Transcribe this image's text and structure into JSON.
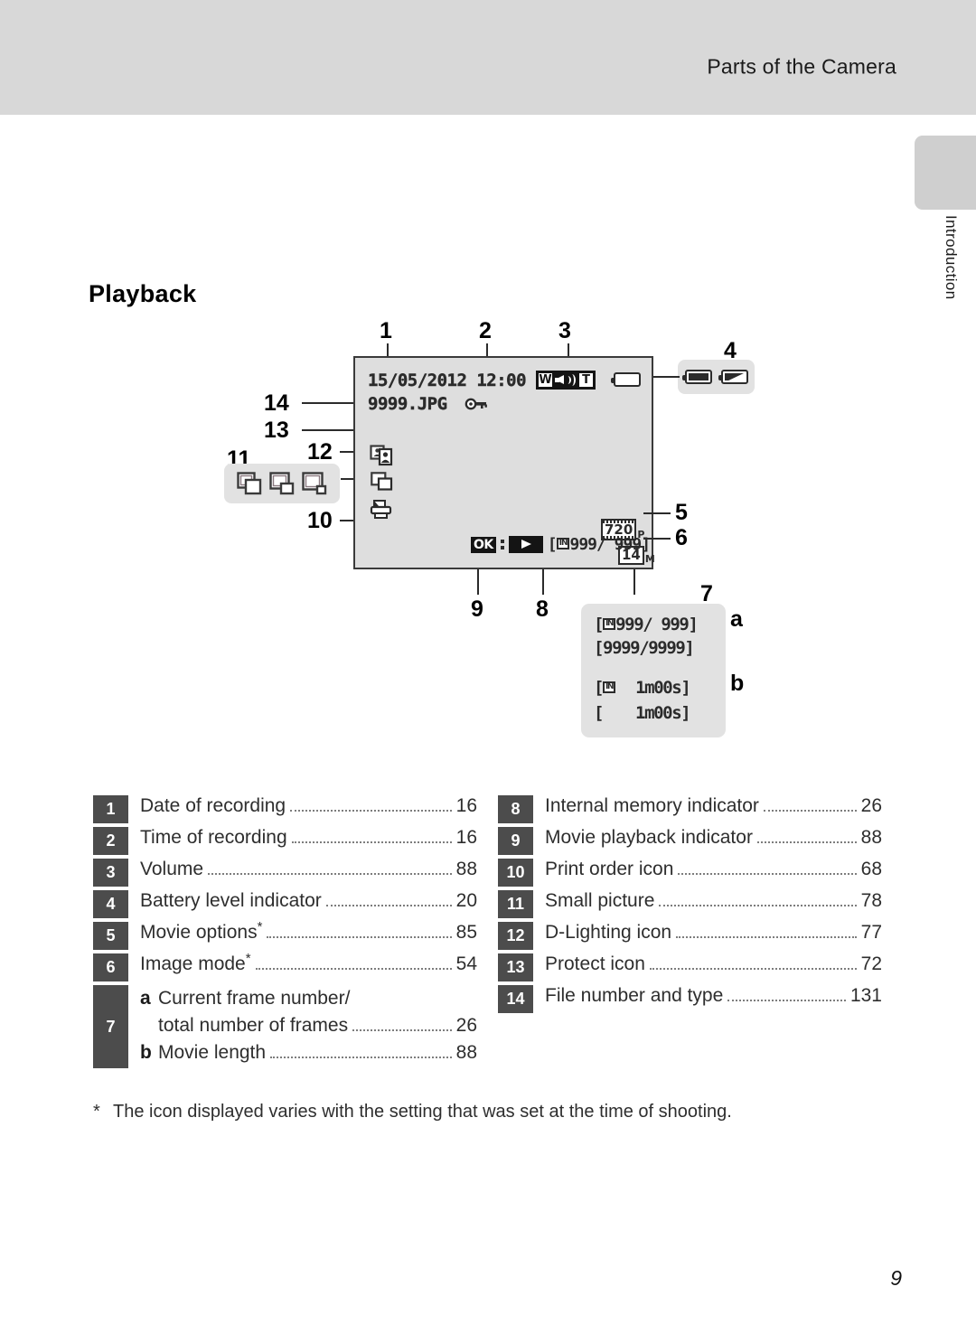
{
  "header": {
    "title": "Parts of the Camera"
  },
  "side_tab": {
    "label": "Introduction"
  },
  "section": {
    "heading": "Playback"
  },
  "lcd": {
    "date": "15/05/2012",
    "time": "12:00",
    "filename": "9999.JPG",
    "volume": {
      "wide_label": "W",
      "tele_label": "T",
      "speaker_icon": "speaker-icon"
    },
    "battery_icon": "battery-icon",
    "movie_options": {
      "value": "720",
      "suffix": "P"
    },
    "image_mode": {
      "value": "14",
      "suffix": "M"
    },
    "bottom": {
      "ok_label": "OK",
      "play_icon": "play-icon",
      "memory_badge": "IN",
      "frame_counter": "999/ 999",
      "bracket_open": "[",
      "bracket_close": "]"
    },
    "icons": {
      "protect": "key-icon",
      "d_lighting": "d-lighting-icon",
      "small_picture": "small-picture-icon",
      "print_order": "printer-icon"
    }
  },
  "battery_group": {
    "icons": [
      "battery-full-icon",
      "battery-low-icon"
    ]
  },
  "small_picture_group": {
    "icons": [
      "small-picture-large-icon",
      "small-picture-medium-icon",
      "small-picture-small-icon"
    ]
  },
  "callouts": {
    "n1": "1",
    "n2": "2",
    "n3": "3",
    "n4": "4",
    "n5": "5",
    "n6": "6",
    "n7": "7",
    "n8": "8",
    "n9": "9",
    "n10": "10",
    "n11": "11",
    "n12": "12",
    "n13": "13",
    "n14": "14",
    "sub_a": "a",
    "sub_b": "b"
  },
  "detail_box": {
    "lines": [
      {
        "badge": "IN",
        "text": "999/ 999",
        "open": "[",
        "close": "]"
      },
      {
        "badge": "",
        "text": "9999/9999",
        "open": "[",
        "close": "]"
      },
      {
        "badge": "IN",
        "text": "1m00s",
        "open": "[",
        "close": "]"
      },
      {
        "badge": "",
        "text": "1m00s",
        "open": "[",
        "close": "]"
      }
    ]
  },
  "legend": {
    "left": [
      {
        "num": "1",
        "label": "Date of recording",
        "page": "16",
        "star": false
      },
      {
        "num": "2",
        "label": "Time of recording",
        "page": "16",
        "star": false
      },
      {
        "num": "3",
        "label": "Volume",
        "page": "88",
        "star": false
      },
      {
        "num": "4",
        "label": "Battery level indicator",
        "page": "20",
        "star": false
      },
      {
        "num": "5",
        "label": "Movie options",
        "page": "85",
        "star": true
      },
      {
        "num": "6",
        "label": "Image mode",
        "page": "54",
        "star": true
      }
    ],
    "row7": {
      "num": "7",
      "a_letter": "a",
      "a_line1": "Current frame number/",
      "a_line2": "total number of frames",
      "a_page": "26",
      "b_letter": "b",
      "b_label": "Movie length",
      "b_page": "88"
    },
    "right": [
      {
        "num": "8",
        "label": "Internal memory indicator",
        "page": "26"
      },
      {
        "num": "9",
        "label": "Movie playback indicator",
        "page": "88"
      },
      {
        "num": "10",
        "label": "Print order icon",
        "page": "68"
      },
      {
        "num": "11",
        "label": "Small picture",
        "page": "78"
      },
      {
        "num": "12",
        "label": "D-Lighting icon",
        "page": "77"
      },
      {
        "num": "13",
        "label": "Protect icon",
        "page": "72"
      },
      {
        "num": "14",
        "label": "File number and type",
        "page": "131"
      }
    ]
  },
  "footnote": {
    "marker": "*",
    "text": "The icon displayed varies with the setting that was set at the time of shooting."
  },
  "page_number": "9",
  "colors": {
    "header_band": "#d8d8d8",
    "badge": "#4c4c4c",
    "lcd_background": "#dedede",
    "group_highlight": "#e2e2e2"
  }
}
